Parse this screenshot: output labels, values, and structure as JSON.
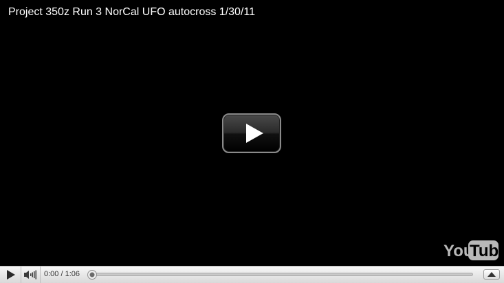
{
  "video": {
    "title": "Project 350z Run 3 NorCal UFO autocross 1/30/11"
  },
  "controls": {
    "current_time": "0:00",
    "separator": "/",
    "duration": "1:06",
    "progress": 0
  },
  "icons": {
    "big_play": "play-icon",
    "play": "play-icon",
    "volume": "speaker-icon",
    "expand": "expand-up-icon",
    "logo": "youtube-logo"
  },
  "logo": {
    "text_you": "You",
    "text_tube": "Tube"
  },
  "colors": {
    "background": "#000000",
    "title_text": "#ffffff",
    "control_bar_top": "#f7f7f7",
    "control_bar_bottom": "#d9d9d9",
    "progress_played": "#cc181e"
  }
}
